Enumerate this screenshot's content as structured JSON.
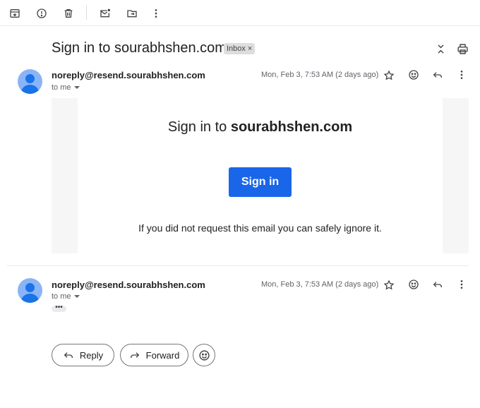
{
  "toolbar": {
    "icons": [
      "archive-icon",
      "report-spam-icon",
      "delete-icon",
      "mark-unread-icon",
      "move-to-icon",
      "more-icon"
    ]
  },
  "email": {
    "subject": "Sign in to sourabhshen.com",
    "label": "Inbox",
    "label_remove": "×"
  },
  "messages": [
    {
      "sender": "noreply@resend.sourabhshen.com",
      "recipient": "to me",
      "date": "Mon, Feb 3, 7:53 AM (2 days ago)"
    },
    {
      "sender": "noreply@resend.sourabhshen.com",
      "recipient": "to me",
      "date": "Mon, Feb 3, 7:53 AM (2 days ago)",
      "trimmed": "•••"
    }
  ],
  "body": {
    "title_prefix": "Sign in to ",
    "title_domain": "sourabhshen.com",
    "button_label": "Sign in",
    "note": "If you did not request this email you can safely ignore it."
  },
  "actions": {
    "reply_label": "Reply",
    "forward_label": "Forward"
  }
}
